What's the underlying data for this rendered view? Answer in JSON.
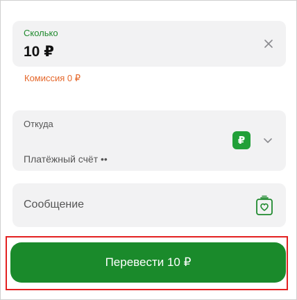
{
  "amount": {
    "label": "Сколько",
    "value": "10 ₽",
    "clear_icon": "close-icon"
  },
  "commission": {
    "text": "Комиссия 0 ₽",
    "color": "#e5672a"
  },
  "source": {
    "label": "Откуда",
    "account_name": "Платёжный счёт ••",
    "badge_symbol": "₽",
    "badge_color": "#21a038",
    "expand_icon": "chevron-down-icon"
  },
  "message": {
    "placeholder": "Сообщение",
    "icon": "greeting-card-icon"
  },
  "transfer_button": {
    "label": "Перевести 10 ₽",
    "color": "#1a8a2b"
  },
  "accent_color": "#1f8a2e"
}
